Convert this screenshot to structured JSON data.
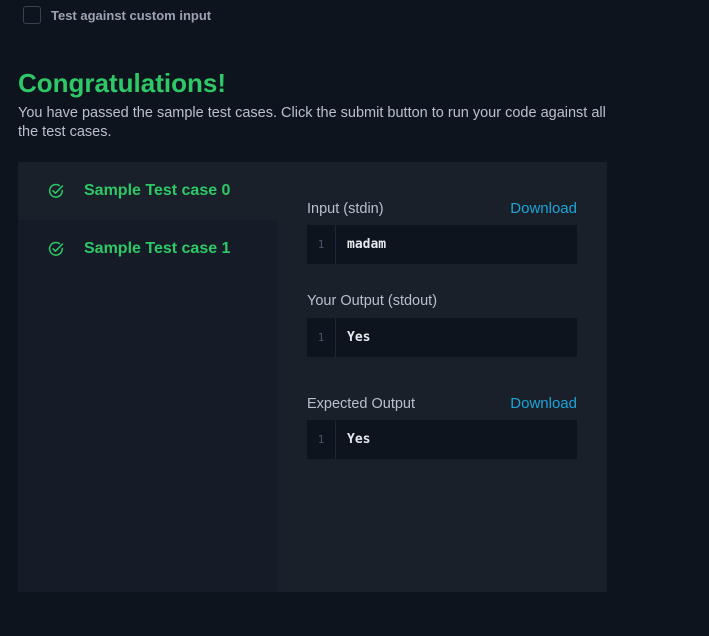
{
  "custom_input": {
    "label": "Test against custom input",
    "checked": false
  },
  "congrats": {
    "title": "Congratulations!",
    "message": "You have passed the sample test cases. Click the submit button to run your code against all the test cases."
  },
  "test_cases": [
    {
      "label": "Sample Test case 0",
      "status": "passed",
      "active": true
    },
    {
      "label": "Sample Test case 1",
      "status": "passed",
      "active": false
    }
  ],
  "details": {
    "input": {
      "label": "Input (stdin)",
      "download_label": "Download",
      "line_number": "1",
      "value": "madam"
    },
    "your_output": {
      "label": "Your Output (stdout)",
      "line_number": "1",
      "value": "Yes"
    },
    "expected_output": {
      "label": "Expected Output",
      "download_label": "Download",
      "line_number": "1",
      "value": "Yes"
    }
  },
  "colors": {
    "success": "#2ec866",
    "link": "#1ba4d8",
    "background": "#0e141e",
    "panel": "#1a2029",
    "sidebar": "#151c28"
  }
}
